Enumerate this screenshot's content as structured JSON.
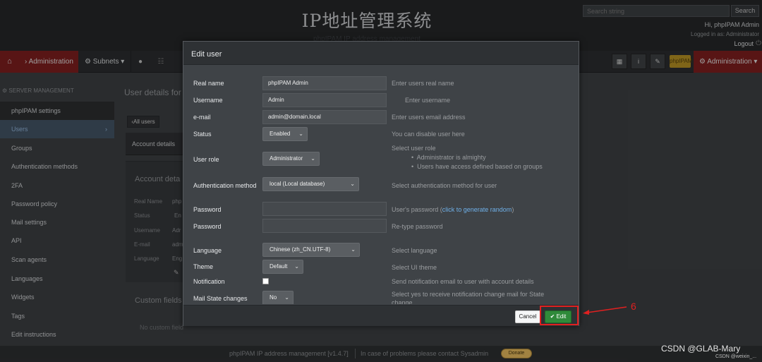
{
  "header": {
    "title": "IP地址管理系统",
    "subtitle": "phpIPAM IP address management",
    "search_placeholder": "Search string",
    "search_button": "Search",
    "greeting": "Hi, phpIPAM Admin",
    "logged_in_as": "Logged in as: Administrator",
    "logout": "Logout"
  },
  "nav": {
    "admin": "Administration",
    "subnets": "Subnets",
    "badge": "phpIPAM",
    "admin_menu": "Administration"
  },
  "sidebar": {
    "header": "SERVER MANAGEMENT",
    "items": [
      {
        "label": "phpIPAM settings"
      },
      {
        "label": "Users"
      },
      {
        "label": "Groups"
      },
      {
        "label": "Authentication methods"
      },
      {
        "label": "2FA"
      },
      {
        "label": "Password policy"
      },
      {
        "label": "Mail settings"
      },
      {
        "label": "API"
      },
      {
        "label": "Scan agents"
      },
      {
        "label": "Languages"
      },
      {
        "label": "Widgets"
      },
      {
        "label": "Tags"
      },
      {
        "label": "Edit instructions"
      }
    ]
  },
  "page": {
    "title": "User details for",
    "all_users": "All users",
    "tab_account": "Account details",
    "account_title": "Account deta",
    "rows": [
      {
        "label": "Real Name",
        "value": "php"
      },
      {
        "label": "Status",
        "value": "En"
      },
      {
        "label": "Username",
        "value": "Adr"
      },
      {
        "label": "E-mail",
        "value": "adm"
      },
      {
        "label": "Language",
        "value": "Eng"
      }
    ],
    "custom_fields_title": "Custom fields",
    "no_custom": "No custom field"
  },
  "modal": {
    "title": "Edit user",
    "fields": {
      "real_name": {
        "label": "Real name",
        "value": "phpIPAM Admin",
        "hint": "Enter users real name"
      },
      "username": {
        "label": "Username",
        "value": "Admin",
        "hint": "Enter username"
      },
      "email": {
        "label": "e-mail",
        "value": "admin@domain.local",
        "hint": "Enter users email address"
      },
      "status": {
        "label": "Status",
        "value": "Enabled",
        "hint": "You can disable user here"
      },
      "role": {
        "label": "User role",
        "value": "Administrator",
        "hint": "Select user role",
        "bullet1": "Administrator is almighty",
        "bullet2": "Users have access defined based on groups"
      },
      "auth": {
        "label": "Authentication method",
        "value": "local (Local database)",
        "hint": "Select authentication method for user"
      },
      "password": {
        "label": "Password",
        "hint_prefix": "User's password (",
        "hint_link": "click to generate random",
        "hint_suffix": ")"
      },
      "password2": {
        "label": "Password",
        "hint": "Re-type password"
      },
      "language": {
        "label": "Language",
        "value": "Chinese (zh_CN.UTF-8)",
        "hint": "Select language"
      },
      "theme": {
        "label": "Theme",
        "value": "Default",
        "hint": "Select UI theme"
      },
      "notification": {
        "label": "Notification",
        "hint": "Send notification email to user with account details"
      },
      "mail_state": {
        "label": "Mail State changes",
        "value": "No",
        "hint": "Select yes to receive notification change mail for State change"
      }
    },
    "cancel": "Cancel",
    "edit": "Edit"
  },
  "footer": {
    "version": "phpIPAM IP address management [v1.4.7]",
    "problems": "In case of problems please contact Sysadmin",
    "donate": "Donate"
  },
  "annotation": {
    "number": "6",
    "color": "#e02020"
  },
  "watermark": {
    "main": "CSDN @GLAB-Mary",
    "small": "CSDN @weixin_..."
  }
}
